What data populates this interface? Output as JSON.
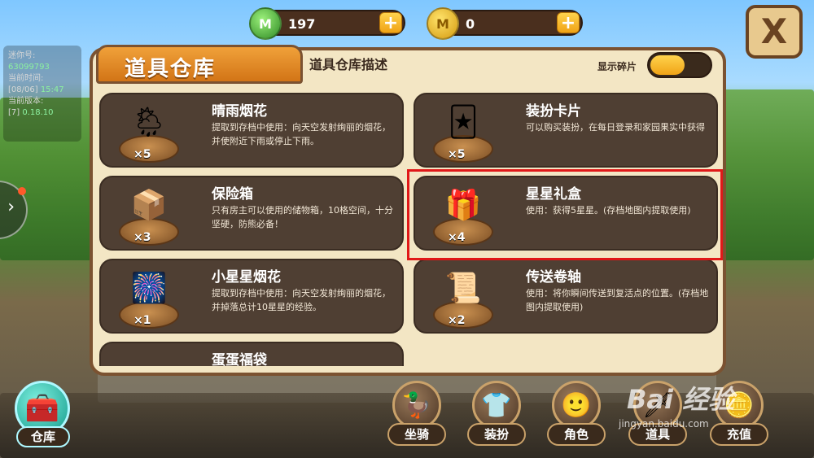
{
  "player_info": {
    "id_label": "迷你号:",
    "id_value": "63099793",
    "time_label": "当前时间:",
    "time_date": "[08/06]",
    "time_clock": "15:47",
    "version_label": "当前版本:",
    "version_prefix": "[7]",
    "version_value": "0.18.10"
  },
  "currency": {
    "green_value": "197",
    "green_icon": "M",
    "gold_value": "0",
    "gold_icon": "M",
    "plus": "+"
  },
  "panel": {
    "title": "道具仓库",
    "desc_label": "道具仓库描述",
    "toggle_label": "显示碎片",
    "close_glyph": "X"
  },
  "items": [
    {
      "name": "晴雨烟花",
      "desc": "提取到存档中使用：向天空发射绚丽的烟花，并使附近下雨或停止下雨。",
      "count": "×5",
      "icon": "🌦"
    },
    {
      "name": "装扮卡片",
      "desc": "可以购买装扮，在每日登录和家园果实中获得",
      "count": "×5",
      "icon": "🃏"
    },
    {
      "name": "保险箱",
      "desc": "只有房主可以使用的储物箱，10格空间，十分坚硬，防熊必备！",
      "count": "×3",
      "icon": "📦"
    },
    {
      "name": "星星礼盒",
      "desc": "使用：获得5星星。(存档地图内提取使用)",
      "count": "×4",
      "icon": "🎁"
    },
    {
      "name": "小星星烟花",
      "desc": "提取到存档中使用：向天空发射绚丽的烟花，并掉落总计10星星的经验。",
      "count": "×1",
      "icon": "🎆"
    },
    {
      "name": "传送卷轴",
      "desc": "使用：将你瞬间传送到复活点的位置。(存档地图内提取使用)",
      "count": "×2",
      "icon": "📜"
    },
    {
      "name": "蛋蛋福袋",
      "desc": "",
      "count": "",
      "icon": ""
    }
  ],
  "bottom_nav": {
    "store": "仓库",
    "mount": "坐骑",
    "outfit": "装扮",
    "character": "角色",
    "tools": "道具",
    "recharge": "充值"
  },
  "watermark": {
    "main": "Bai 经验",
    "sub": "jingyan.baidu.com"
  }
}
